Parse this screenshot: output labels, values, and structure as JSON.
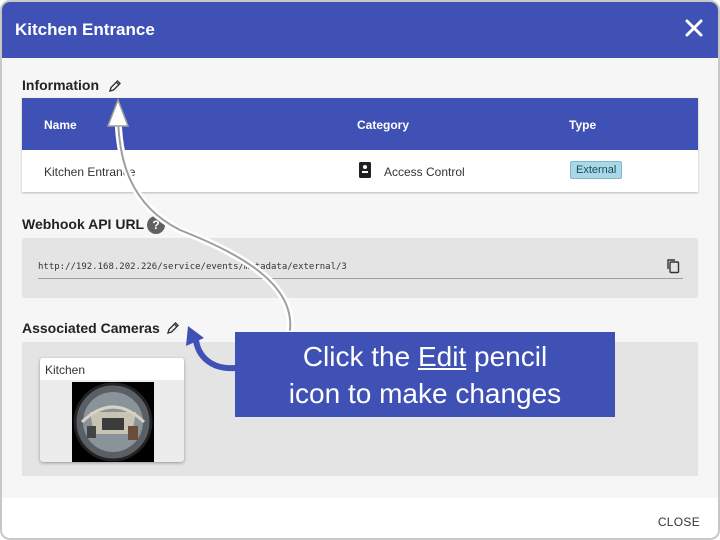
{
  "dialog": {
    "title": "Kitchen Entrance",
    "close_icon": "close-icon"
  },
  "information": {
    "label": "Information",
    "edit_icon": "pencil-icon",
    "columns": [
      "Name",
      "Category",
      "Type"
    ],
    "row": {
      "name": "Kitchen Entrance",
      "category": "Access Control",
      "category_icon": "access-control-icon",
      "type": "External"
    }
  },
  "webhook": {
    "label": "Webhook API URL",
    "help": "?",
    "url": "http://192.168.202.226/service/events/metadata/external/3",
    "copy_icon": "copy-icon"
  },
  "cameras": {
    "label": "Associated Cameras",
    "edit_icon": "pencil-icon",
    "items": [
      {
        "name": "Kitchen"
      }
    ]
  },
  "footer": {
    "close_label": "CLOSE"
  },
  "callout": {
    "before": "Click the",
    "emphasis": "Edit",
    "after_line1": "pencil",
    "line2": "icon to make changes"
  },
  "colors": {
    "primary": "#3f51b5",
    "badge": "#a9d8e6"
  }
}
